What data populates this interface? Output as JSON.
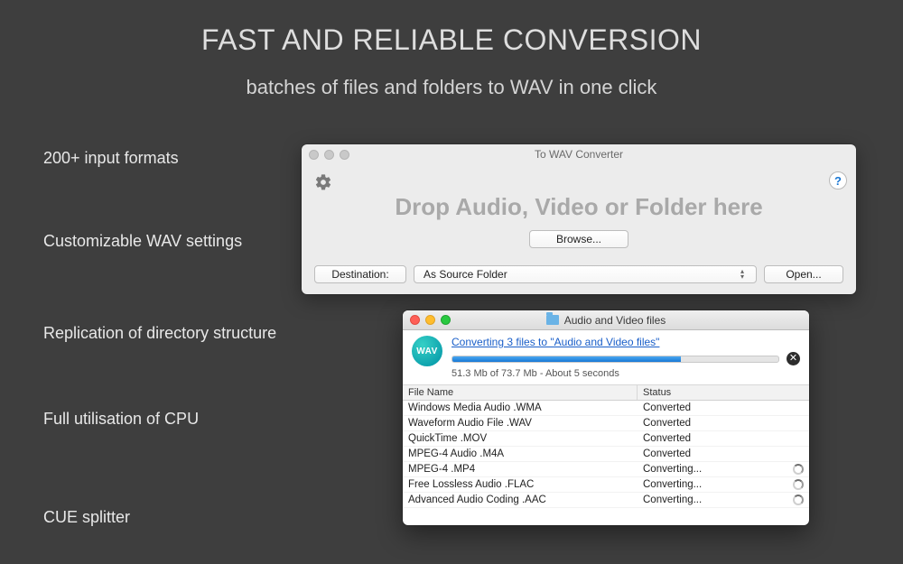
{
  "headline": "FAST AND RELIABLE CONVERSION",
  "subhead": "batches of files and folders to WAV in one click",
  "features": [
    "200+ input formats",
    "Customizable WAV settings",
    "Replication of directory structure",
    "Full utilisation of CPU",
    "CUE splitter"
  ],
  "main_window": {
    "title": "To WAV Converter",
    "dropzone_text": "Drop Audio, Video or Folder here",
    "browse_label": "Browse...",
    "destination_label": "Destination:",
    "destination_value": "As Source Folder",
    "open_label": "Open...",
    "help_glyph": "?"
  },
  "progress_window": {
    "title": "Audio and Video files",
    "badge_text": "WAV",
    "status_link": "Converting 3 files to \"Audio and Video files\"",
    "progress_percent": 70,
    "progress_text": "51.3 Mb of 73.7 Mb - About 5 seconds",
    "cancel_glyph": "✕",
    "columns": {
      "name": "File Name",
      "status": "Status"
    },
    "rows": [
      {
        "name": "Windows Media Audio .WMA",
        "status": "Converted",
        "busy": false
      },
      {
        "name": "Waveform Audio File .WAV",
        "status": "Converted",
        "busy": false
      },
      {
        "name": "QuickTime .MOV",
        "status": "Converted",
        "busy": false
      },
      {
        "name": "MPEG-4 Audio .M4A",
        "status": "Converted",
        "busy": false
      },
      {
        "name": "MPEG-4 .MP4",
        "status": "Converting...",
        "busy": true
      },
      {
        "name": "Free Lossless Audio .FLAC",
        "status": "Converting...",
        "busy": true
      },
      {
        "name": "Advanced Audio Coding .AAC",
        "status": "Converting...",
        "busy": true
      }
    ]
  }
}
